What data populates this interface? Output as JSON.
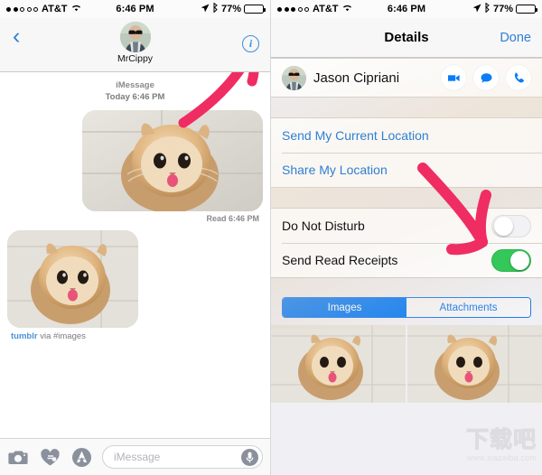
{
  "left": {
    "statusbar": {
      "signal_dots_filled": 2,
      "signal_dots_total": 5,
      "carrier": "AT&T",
      "wifi_icon": "wifi-icon",
      "time": "6:46 PM",
      "location_icon": "location-arrow-icon",
      "bluetooth_icon": "bluetooth-icon",
      "battery_percent": "77%",
      "battery_level": 77
    },
    "navbar": {
      "back_icon": "chevron-left-icon",
      "contact_name": "MrCippy",
      "avatar_name": "contact-avatar",
      "info_label": "i",
      "info_icon": "info-circle-icon"
    },
    "thread": {
      "service": "iMessage",
      "timestamp": "Today 6:46 PM",
      "messages": [
        {
          "direction": "outgoing",
          "type": "image",
          "alt": "kitten-photo",
          "status": "Read 6:46 PM"
        },
        {
          "direction": "incoming",
          "type": "image",
          "alt": "kitten-photo",
          "attribution_source": "tumblr",
          "attribution_rest": " via #images"
        }
      ]
    },
    "toolbar": {
      "camera_icon": "camera-icon",
      "digital_touch_icon": "heart-digital-touch-icon",
      "app_store_icon": "app-store-icon",
      "input_placeholder": "iMessage",
      "input_value": "",
      "mic_icon": "microphone-icon"
    }
  },
  "right": {
    "statusbar": {
      "signal_dots_filled": 3,
      "signal_dots_total": 5,
      "carrier": "AT&T",
      "wifi_icon": "wifi-icon",
      "time": "6:46 PM",
      "location_icon": "location-arrow-icon",
      "bluetooth_icon": "bluetooth-icon",
      "battery_percent": "77%",
      "battery_level": 77
    },
    "navbar": {
      "title": "Details",
      "done_label": "Done"
    },
    "contact": {
      "name": "Jason Cipriani",
      "avatar_name": "contact-avatar",
      "actions": [
        {
          "name": "facetime-video-button",
          "icon": "video-camera-icon"
        },
        {
          "name": "send-message-button",
          "icon": "speech-bubble-icon"
        },
        {
          "name": "call-button",
          "icon": "phone-handset-icon"
        }
      ]
    },
    "location_rows": [
      {
        "label": "Send My Current Location",
        "name": "send-current-location-row"
      },
      {
        "label": "Share My Location",
        "name": "share-my-location-row"
      }
    ],
    "toggle_rows": [
      {
        "label": "Do Not Disturb",
        "name": "do-not-disturb-row",
        "on": false
      },
      {
        "label": "Send Read Receipts",
        "name": "send-read-receipts-row",
        "on": true
      }
    ],
    "segmented": {
      "options": [
        "Images",
        "Attachments"
      ],
      "selected_index": 0
    },
    "attachments": [
      {
        "alt": "kitten-thumbnail"
      },
      {
        "alt": "kitten-thumbnail"
      }
    ]
  },
  "annotations": [
    {
      "name": "arrow-to-info-button",
      "color": "#ef2d63",
      "target": "info-circle-icon"
    },
    {
      "name": "arrow-to-read-receipts-toggle",
      "color": "#ef2d63",
      "target": "send-read-receipts-toggle"
    }
  ],
  "watermark": {
    "text_cn": "下载吧",
    "url": "www.xiazaiba.com"
  },
  "colors": {
    "accent_blue": "#2f7fd4",
    "segment_blue": "#0a7cf7",
    "toggle_green": "#34c759",
    "annotation_pink": "#ef2d63",
    "panel_bg": "#efeff4",
    "navbar_bg": "#f7f7f7"
  }
}
